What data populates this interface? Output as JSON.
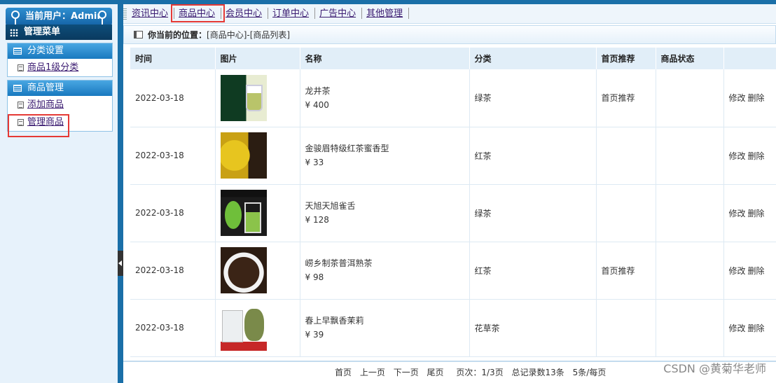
{
  "sidebar": {
    "current_user": "当前用户：Admin",
    "menu_title": "管理菜单",
    "groups": [
      {
        "title": "分类设置",
        "items": [
          "商品1级分类"
        ]
      },
      {
        "title": "商品管理",
        "items": [
          "添加商品",
          "管理商品"
        ]
      }
    ]
  },
  "nav": {
    "tabs": [
      "资讯中心",
      "商品中心",
      "会员中心",
      "订单中心",
      "广告中心",
      "其他管理"
    ]
  },
  "breadcrumb": {
    "label": "你当前的位置：",
    "path": "[商品中心]-[商品列表]"
  },
  "table": {
    "headers": [
      "时间",
      "图片",
      "名称",
      "分类",
      "首页推荐",
      "商品状态",
      ""
    ],
    "rows": [
      {
        "date": "2022-03-18",
        "name": "龙井茶",
        "price": "¥ 400",
        "category": "绿茶",
        "recommend": "首页推荐",
        "status": "",
        "edit": "修改",
        "delete": "删除"
      },
      {
        "date": "2022-03-18",
        "name": "金骏眉特级红茶蜜香型",
        "price": "¥ 33",
        "category": "红茶",
        "recommend": "",
        "status": "",
        "edit": "修改",
        "delete": "删除"
      },
      {
        "date": "2022-03-18",
        "name": "天旭天旭雀舌",
        "price": "¥ 128",
        "category": "绿茶",
        "recommend": "",
        "status": "",
        "edit": "修改",
        "delete": "删除"
      },
      {
        "date": "2022-03-18",
        "name": "崂乡制茶普洱熟茶",
        "price": "¥ 98",
        "category": "红茶",
        "recommend": "首页推荐",
        "status": "",
        "edit": "修改",
        "delete": "删除"
      },
      {
        "date": "2022-03-18",
        "name": "春上早飘香茉莉",
        "price": "¥ 39",
        "category": "花草茶",
        "recommend": "",
        "status": "",
        "edit": "修改",
        "delete": "删除"
      }
    ]
  },
  "pager": {
    "first": "首页",
    "prev": "上一页",
    "next": "下一页",
    "last": "尾页",
    "page_info": "页次：1/3页",
    "total": "总记录数13条",
    "per_page": "5条/每页"
  },
  "watermark": "CSDN @黄菊华老师",
  "colors": {
    "accent": "#1a6fa8",
    "highlight": "#e53935",
    "link": "#3a1a70"
  }
}
